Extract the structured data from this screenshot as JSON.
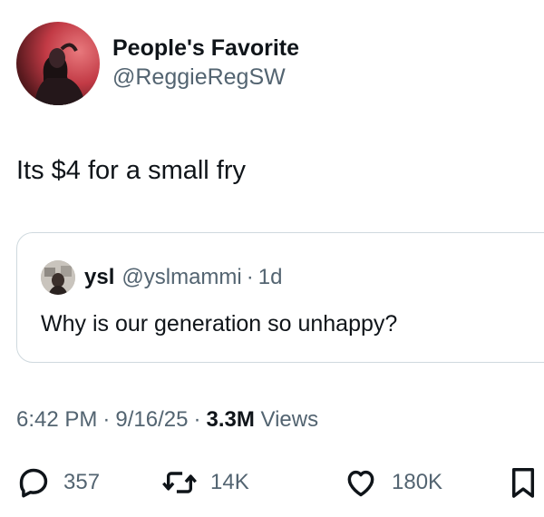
{
  "author": {
    "display_name": "People's Favorite",
    "handle": "@ReggieRegSW",
    "avatar_icon": "profile-photo"
  },
  "tweet": {
    "text": "Its $4 for a small fry"
  },
  "quoted_tweet": {
    "display_name": "ysl",
    "handle": "@yslmammi",
    "separator": "·",
    "time": "1d",
    "text": "Why is our generation so unhappy?"
  },
  "meta": {
    "time": "6:42 PM",
    "date": "9/16/25",
    "separator": "·",
    "views_count": "3.3M",
    "views_label": "Views"
  },
  "actions": {
    "replies": "357",
    "reposts": "14K",
    "likes": "180K"
  },
  "colors": {
    "text": "#0f1419",
    "secondary": "#536471",
    "border": "#cfd9de"
  }
}
